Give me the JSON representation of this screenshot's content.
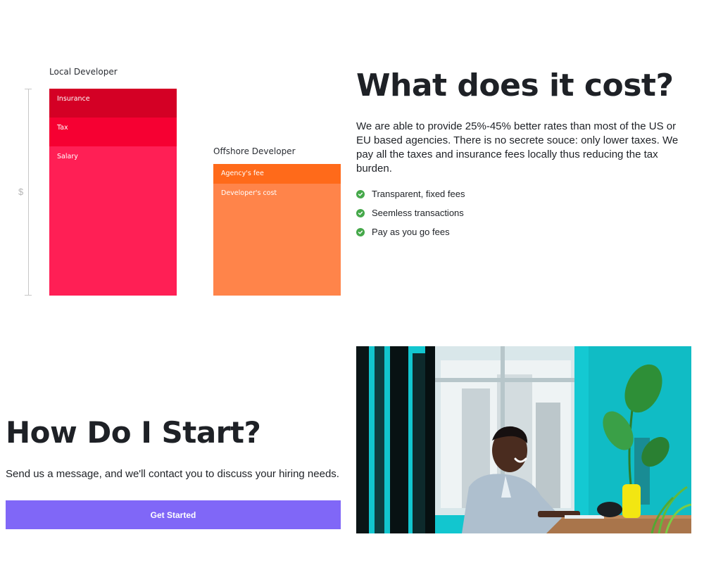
{
  "cost_diagram": {
    "local": {
      "label": "Local Developer",
      "segments": [
        {
          "label": "Insurance",
          "color": "#d40025"
        },
        {
          "label": "Tax",
          "color": "#f60032"
        },
        {
          "label": "Salary",
          "color": "#ff1f55"
        }
      ]
    },
    "offshore": {
      "label": "Offshore Developer",
      "segments": [
        {
          "label": "Agency's fee",
          "color": "#ff6a1a"
        },
        {
          "label": "Developer's cost",
          "color": "#ff844a"
        }
      ]
    },
    "axis_symbol": "$"
  },
  "cost_section": {
    "title": "What does it cost?",
    "body": "We are able to provide 25%-45% better rates than most of the US or EU based agencies. There is no secrete souce: only lower taxes. We pay all the taxes and insurance fees locally thus reducing the tax burden.",
    "benefits": [
      "Transparent, fixed fees",
      "Seemless transactions",
      "Pay as you go fees"
    ],
    "check_color": "#45a84a"
  },
  "start_section": {
    "title": "How Do I Start?",
    "body": "Send us a message, and we'll contact you to discuss your hiring needs.",
    "cta_label": "Get Started",
    "cta_color": "#8067f7"
  },
  "photo": {
    "icon": "office-photo"
  }
}
